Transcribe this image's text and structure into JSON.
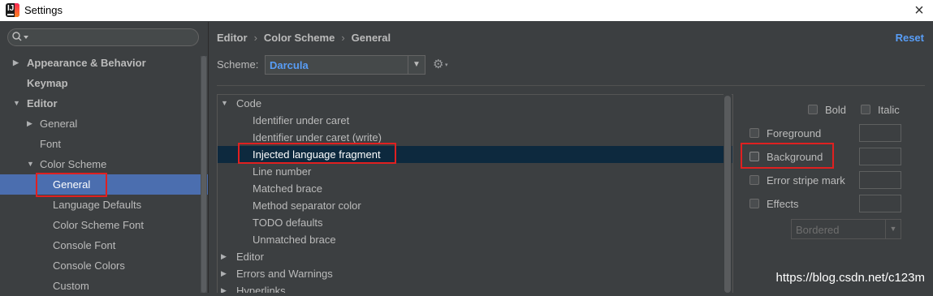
{
  "window": {
    "title": "Settings",
    "close_icon": "×"
  },
  "sidebar": {
    "search_placeholder": "",
    "items": [
      {
        "label": "Appearance & Behavior",
        "arrow": "▶"
      },
      {
        "label": "Keymap",
        "arrow": ""
      },
      {
        "label": "Editor",
        "arrow": "▼"
      },
      {
        "label": "General",
        "arrow": "▶"
      },
      {
        "label": "Font",
        "arrow": ""
      },
      {
        "label": "Color Scheme",
        "arrow": "▼"
      },
      {
        "label": "General",
        "arrow": ""
      },
      {
        "label": "Language Defaults",
        "arrow": ""
      },
      {
        "label": "Color Scheme Font",
        "arrow": ""
      },
      {
        "label": "Console Font",
        "arrow": ""
      },
      {
        "label": "Console Colors",
        "arrow": ""
      },
      {
        "label": "Custom",
        "arrow": ""
      }
    ]
  },
  "header": {
    "breadcrumb": [
      "Editor",
      "Color Scheme",
      "General"
    ],
    "separator": "›",
    "reset_label": "Reset"
  },
  "scheme": {
    "label": "Scheme:",
    "value": "Darcula",
    "dropdown_arrow": "▼",
    "gear": "⚙",
    "gear_arrow": "▾"
  },
  "tree": {
    "items": [
      {
        "label": "Code",
        "arrow": "▼"
      },
      {
        "label": "Identifier under caret",
        "arrow": ""
      },
      {
        "label": "Identifier under caret (write)",
        "arrow": ""
      },
      {
        "label": "Injected language fragment",
        "arrow": ""
      },
      {
        "label": "Line number",
        "arrow": ""
      },
      {
        "label": "Matched brace",
        "arrow": ""
      },
      {
        "label": "Method separator color",
        "arrow": ""
      },
      {
        "label": "TODO defaults",
        "arrow": ""
      },
      {
        "label": "Unmatched brace",
        "arrow": ""
      },
      {
        "label": "Editor",
        "arrow": "▶"
      },
      {
        "label": "Errors and Warnings",
        "arrow": "▶"
      },
      {
        "label": "Hyperlinks",
        "arrow": "▶"
      }
    ]
  },
  "options": {
    "bold": "Bold",
    "italic": "Italic",
    "foreground": "Foreground",
    "background": "Background",
    "error_stripe": "Error stripe mark",
    "effects": "Effects",
    "effects_value": "Bordered",
    "effects_arrow": "▼"
  },
  "watermark": "https://blog.csdn.net/c123m",
  "colors": {
    "accent": "#589df6",
    "selection": "#4b6eaf",
    "tree_selection": "#0d293e",
    "highlight": "#e02020"
  }
}
